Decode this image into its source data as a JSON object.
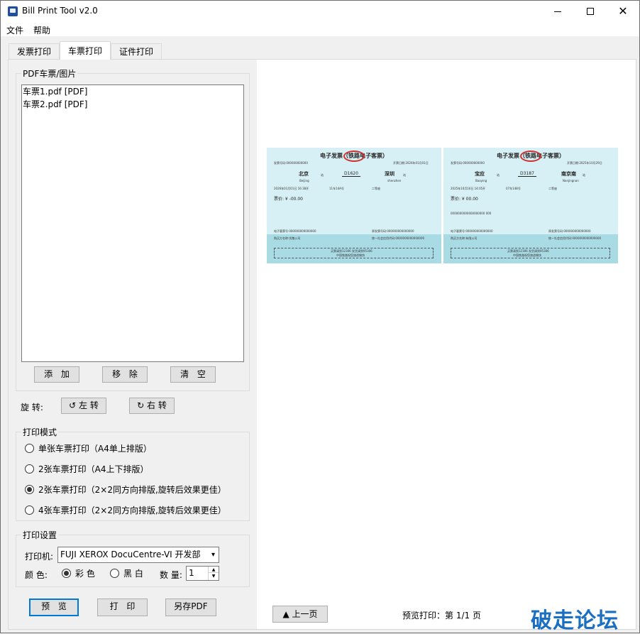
{
  "window": {
    "title": "Bill Print Tool v2.0",
    "min_symbol": "—",
    "close_symbol": "✕"
  },
  "menu": {
    "file": "文件",
    "help": "帮助"
  },
  "tabs": [
    {
      "label": "发票打印",
      "active": false
    },
    {
      "label": "车票打印",
      "active": true
    },
    {
      "label": "证件打印",
      "active": false
    }
  ],
  "files_group": {
    "title": "PDF车票/图片",
    "items": [
      "车票1.pdf [PDF]",
      "车票2.pdf [PDF]"
    ],
    "add": "添 加",
    "remove": "移 除",
    "clear": "清 空"
  },
  "rotate": {
    "label": "旋 转:",
    "left": "↺ 左 转",
    "right": "↻ 右 转"
  },
  "mode_group": {
    "title": "打印模式",
    "options": [
      "单张车票打印（A4单上排版）",
      "2张车票打印（A4上下排版）",
      "2张车票打印（2×2同方向排版,旋转后效果更佳）",
      "4张车票打印（2×2同方向排版,旋转后效果更佳）"
    ],
    "selected_index": 2
  },
  "settings_group": {
    "title": "打印设置",
    "printer_label": "打印机:",
    "printer_value": "FUJI XEROX DocuCentre-VI 开发部",
    "color_label": "颜  色:",
    "color_options": [
      "彩 色",
      "黑 白"
    ],
    "color_selected": "彩 色",
    "qty_label": "数 量:",
    "qty_value": "1"
  },
  "actions": {
    "preview": "预 览",
    "print": "打 印",
    "save_pdf": "另存PDF"
  },
  "preview_nav": {
    "prev": "▲ 上一页",
    "status": "预览打印：第 1/1 页"
  },
  "tickets": [
    {
      "title": "电子发票（铁路电子客票）",
      "invoice_no": "发票号码:000000000000",
      "issue_date": "开票日期:2026年01月01日",
      "from": "北京",
      "from_pinyin": "Beijing",
      "station_suffix": "站",
      "train": "D1620",
      "to": "深圳",
      "to_pinyin": "shenzhen",
      "depart": "2026年01月01日    16:38开",
      "seat": "11车14A号",
      "class": "二等座",
      "price": "票价: ¥ -00.00",
      "extra": "",
      "etk_no": "电子客票号:000000000000000",
      "buyer": "购买方名称:优敬公司",
      "orig_invoice": "原发票号码:000000000000000",
      "credit_code": "统一社会信用代码:0000000000000000",
      "footer1": "买票请到12306  发货请到95306",
      "footer2": "中国铁路祝您旅途愉快"
    },
    {
      "title": "电子发票（铁路电子客票）",
      "invoice_no": "发票号码:000000000000",
      "issue_date": "开票日期:2025年10月29日",
      "from": "宝应",
      "from_pinyin": "Baoying",
      "station_suffix": "站",
      "train": "D3187",
      "to": "南京南",
      "to_pinyin": "Nanjingnan",
      "depart": "2025年10月16日    14:05开",
      "seat": "07车14B号",
      "class": "二等座",
      "price": "票价: ¥ 00.00",
      "extra": "0000000000000000000        000",
      "etk_no": "电子客票号:000000000000000",
      "buyer": "购买方名称:有限公司",
      "orig_invoice": "原发票号码:000000000000000",
      "credit_code": "统一社会信用代码:0000000000000000",
      "footer1": "买票请到12306  发货请到95306",
      "footer2": "中国铁路祝您旅途愉快"
    }
  ],
  "watermark": "破走论坛"
}
